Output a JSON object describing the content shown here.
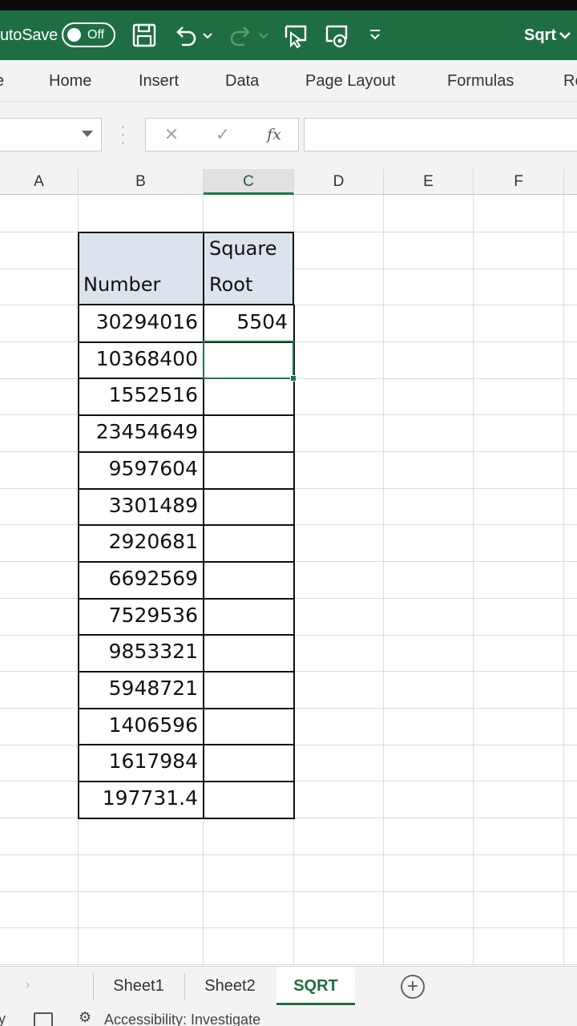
{
  "titlebar": {
    "autosave_label": "utoSave",
    "autosave_state": "Off",
    "file_name": "Sqrt"
  },
  "ribbon": {
    "tabs": [
      "e",
      "Home",
      "Insert",
      "Data",
      "Page Layout",
      "Formulas",
      "Re"
    ]
  },
  "formula_bar": {
    "name_box": "",
    "formula": "",
    "fx_label": "fx"
  },
  "columns": [
    "A",
    "B",
    "C",
    "D",
    "E",
    "F"
  ],
  "table": {
    "header_number": "Number",
    "header_sqrt_line1": "Square",
    "header_sqrt_line2": "Root",
    "numbers": [
      "30294016",
      "10368400",
      "1552516",
      "23454649",
      "9597604",
      "3301489",
      "2920681",
      "6692569",
      "7529536",
      "9853321",
      "5948721",
      "1406596",
      "1617984",
      "197731.4"
    ],
    "roots": [
      "5504",
      "",
      "",
      "",
      "",
      "",
      "",
      "",
      "",
      "",
      "",
      "",
      "",
      ""
    ]
  },
  "sheets": {
    "tabs": [
      "Sheet1",
      "Sheet2",
      "SQRT"
    ],
    "active": "SQRT"
  },
  "status": {
    "left": "y",
    "accessibility": "Accessibility: Investigate"
  },
  "colors": {
    "brand": "#1f6e43",
    "accent": "#217346",
    "header_fill": "#dce3ed"
  }
}
